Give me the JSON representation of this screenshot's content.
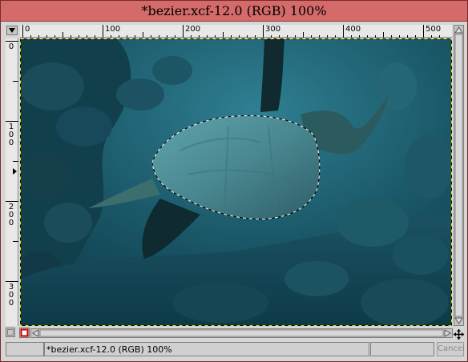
{
  "window": {
    "title": "*bezier.xcf-12.0 (RGB) 100%"
  },
  "rulers": {
    "horizontal_labels": [
      "0",
      "100",
      "200",
      "300",
      "400",
      "500"
    ],
    "vertical_labels": [
      "0",
      "100",
      "200",
      "300"
    ]
  },
  "status": {
    "text": "*bezier.xcf-12.0 (RGB) 100%",
    "cancel_label": "Cancel"
  },
  "icons": {
    "menu": "menu-arrow-icon",
    "quickmask": "quickmask-toggle-icon",
    "navigate": "navigate-cross-icon"
  },
  "colors": {
    "titlebar": "#d46a6a",
    "selection_outline": "#ffffff"
  }
}
